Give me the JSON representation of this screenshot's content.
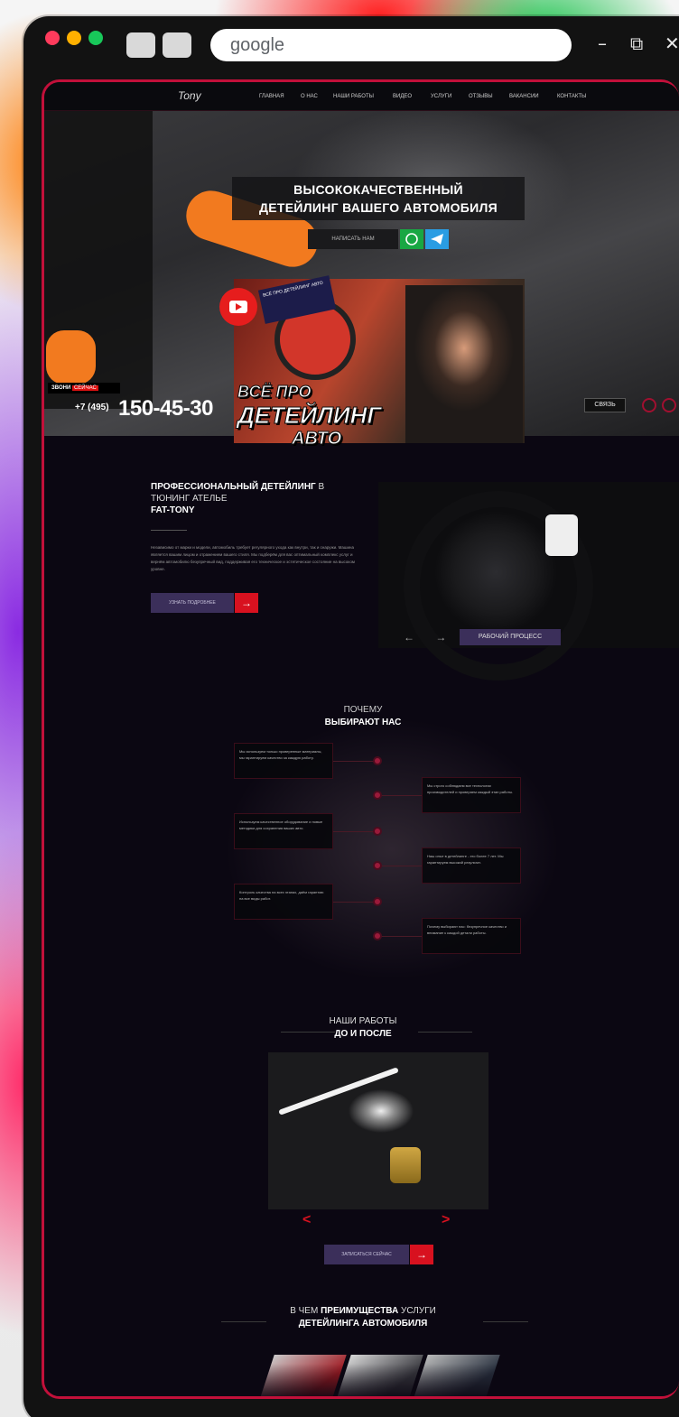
{
  "browser": {
    "url_text": "google",
    "window_controls": [
      "–",
      "⧉",
      "✕"
    ],
    "traffic_colors": [
      "#ff3b5c",
      "#ffb000",
      "#18c85a"
    ]
  },
  "site": {
    "logo": "Tony",
    "nav": [
      "ГЛАВНАЯ",
      "О НАС",
      "НАШИ РАБОТЫ",
      "ВИДЕО",
      "УСЛУГИ",
      "ОТЗЫВЫ",
      "ВАКАНСИИ",
      "КОНТАКТЫ"
    ],
    "hero": {
      "headline_line1": "ВЫСОКОКАЧЕСТВЕННЫЙ",
      "headline_line2": "ДЕТЕЙЛИНГ ВАШЕГО АВТОМОБИЛЯ",
      "cta_label": "НАПИСАТЬ НАМ",
      "video_badge": "ВСЁ ПРО ДЕТЕЙЛИНГ АВТО",
      "video_title_line1": "ВСЁ ПРО",
      "video_title_line2": "ДЕТЕЙЛИНГ",
      "video_title_line3": "АВТО",
      "phone_tag_prefix": "ЗВОНИ",
      "phone_tag_highlight": "СЕЙЧАС",
      "phone_prefix": "+7 (495)",
      "phone_number": "150-45-30",
      "right_pill": "СВЯЗЬ"
    },
    "about": {
      "title_bold": "ПРОФЕССИОНАЛЬНЫЙ ДЕТЕЙЛИНГ",
      "title_thin": "В ТЮНИНГ АТЕЛЬЕ",
      "title_brand": "FAT-TONY",
      "body": "Независимо от марки и модели, автомобиль требует регулярного ухода как внутри, так и снаружи. Машина является вашим лицом и отражением вашего стиля. Мы подберём для вас оптимальный комплекс услуг и вернём автомобилю безупречный вид, поддерживая его техническое и эстетическое состояние на высоком уровне.",
      "button_label": "УЗНАТЬ ПОДРОБНЕЕ",
      "arrow": "→",
      "slider_label": "РАБОЧИЙ ПРОЦЕСС",
      "slider_prev": "←",
      "slider_next": "→"
    },
    "why": {
      "title_line1": "ПОЧЕМУ",
      "title_line2": "ВЫБИРАЮТ НАС",
      "reasons": [
        "Мы используем только проверенные материалы, мы гарантируем качество за каждую работу.",
        "Мы строго соблюдаем все технологии производителей и проверяем каждый этап работы.",
        "Используем качественное оборудование и новые методики для сохранения ваших авто.",
        "Наш опыт в детейлинге - это более 7 лет. Мы гарантируем высокий результат.",
        "Контроль качества на всех этапах, даём гарантию на все виды работ.",
        "Почему выбирают нас: безупречное качество и внимание к каждой детали работы."
      ]
    },
    "works": {
      "title_line1": "НАШИ РАБОТЫ",
      "title_line2": "ДО И ПОСЛЕ",
      "prev": "<",
      "next": ">",
      "button_label": "ЗАПИСАТЬСЯ СЕЙЧАС",
      "arrow": "→"
    },
    "advantages": {
      "title_pre": "В ЧЕМ",
      "title_bold": "ПРЕИМУЩЕСТВА",
      "title_post": "УСЛУГИ",
      "title_line2": "ДЕТЕЙЛИНГА АВТОМОБИЛЯ"
    }
  }
}
